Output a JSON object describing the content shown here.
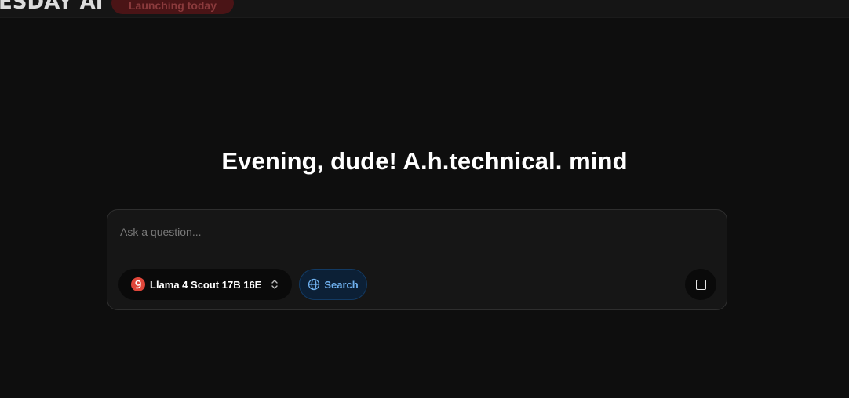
{
  "header": {
    "brand": "ESDAY AI",
    "badge": "Launching today"
  },
  "main": {
    "greeting": "Evening, dude! A.h.technical. mind"
  },
  "composer": {
    "placeholder": "Ask a question...",
    "value": "",
    "model": {
      "label": "Llama 4 Scout 17B 16E",
      "icon": "model-brand-icon",
      "icon_color": "#e0463a"
    },
    "search": {
      "label": "Search",
      "icon": "globe-icon",
      "accent": "#6fb0ee"
    },
    "stop": {
      "icon": "stop-icon"
    }
  },
  "colors": {
    "background": "#0e0e0e",
    "composer_bg": "#161616",
    "badge_bg": "#4a1416"
  }
}
